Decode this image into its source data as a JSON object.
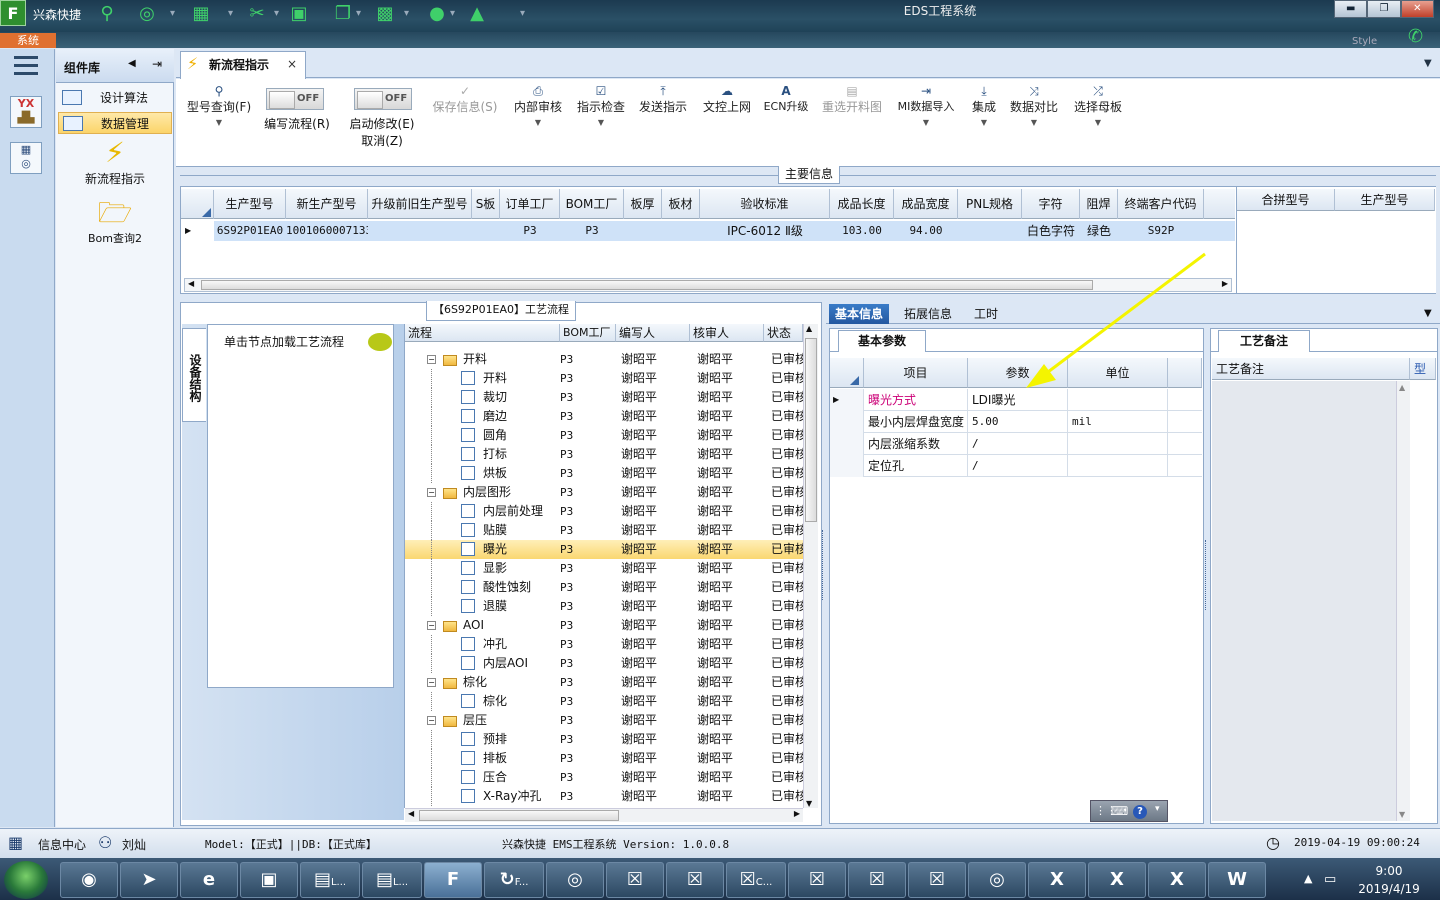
{
  "app": {
    "short_name": "兴森快捷",
    "window_title": "EDS工程系统",
    "system_tab": "系统",
    "style_label": "Style"
  },
  "quick_access": [
    {
      "icon": "search-icon"
    },
    {
      "icon": "lifebuoy-icon"
    },
    {
      "icon": "grid-icon"
    },
    {
      "icon": "scissors-icon"
    },
    {
      "icon": "film-icon"
    },
    {
      "icon": "copy-icon"
    },
    {
      "icon": "apps-icon"
    },
    {
      "icon": "user-icon"
    },
    {
      "icon": "chart-icon"
    }
  ],
  "window_controls": {
    "minimize": "▬",
    "restore": "❐",
    "close": "✕"
  },
  "left_strip": {
    "icon1_text": "YX",
    "icons": [
      "menu-icon",
      "factory-icon",
      "calendar-icon"
    ]
  },
  "component_panel": {
    "title": "组件库",
    "items": [
      {
        "label": "设计算法"
      },
      {
        "label": "数据管理"
      }
    ],
    "big_items": [
      {
        "label": "新流程指示",
        "icon": "lightning-icon"
      },
      {
        "label": "Bom查询2",
        "icon": "folder-open-icon"
      }
    ]
  },
  "doc_tab": {
    "label": "新流程指示",
    "close": "×"
  },
  "toolbar": {
    "items": [
      {
        "label": "型号查询(F)",
        "icon": "search-icon"
      },
      {
        "label": "保存信息(S)",
        "icon": "check-icon",
        "disabled": true
      },
      {
        "label": "内部审核",
        "icon": "printer-icon"
      },
      {
        "label": "指示检查",
        "icon": "checkbox-icon"
      },
      {
        "label": "发送指示",
        "icon": "upload-icon"
      },
      {
        "label": "文控上网",
        "icon": "cloud-upload-icon"
      },
      {
        "label": "ECN升级",
        "icon": "letter-a-icon"
      },
      {
        "label": "重选开料图",
        "icon": "image-icon",
        "disabled": true
      },
      {
        "label": "MI数据导入",
        "icon": "import-icon"
      },
      {
        "label": "集成",
        "icon": "download-icon"
      },
      {
        "label": "数据对比",
        "icon": "compare-icon"
      },
      {
        "label": "选择母板",
        "icon": "shuffle-icon"
      }
    ],
    "toggles": [
      {
        "state": "OFF",
        "label": "编写流程(R)"
      },
      {
        "state": "OFF",
        "label1": "启动修改(E)",
        "label2": "取消(Z)"
      }
    ]
  },
  "main_info": {
    "title": "主要信息",
    "columns": [
      "生产型号",
      "新生产型号",
      "升级前旧生产型号",
      "S板",
      "订单工厂",
      "BOM工厂",
      "板厚",
      "板材",
      "验收标准",
      "成品长度",
      "成品宽度",
      "PNL规格",
      "字符",
      "阻焊",
      "终端客户代码"
    ],
    "row": [
      "6S92P01EA0",
      "10010600071339",
      "",
      "",
      "P3",
      "P3",
      "",
      "",
      "IPC-6012 Ⅱ级",
      "103.00",
      "94.00",
      "",
      "白色字符",
      "绿色",
      "S92P"
    ],
    "side_columns": [
      "合拼型号",
      "生产型号"
    ]
  },
  "process": {
    "title": "【6S92P01EA0】工艺流程",
    "side_tab": "设备结构",
    "hint": "单击节点加载工艺流程",
    "columns": [
      "流程",
      "BOM工厂",
      "编写人",
      "核审人",
      "状态"
    ],
    "rows": [
      {
        "level": 0,
        "name": "开料",
        "factory": "P3",
        "writer": "谢昭平",
        "reviewer": "谢昭平",
        "status": "已审核"
      },
      {
        "level": 1,
        "name": "开料",
        "factory": "P3",
        "writer": "谢昭平",
        "reviewer": "谢昭平",
        "status": "已审核"
      },
      {
        "level": 1,
        "name": "裁切",
        "factory": "P3",
        "writer": "谢昭平",
        "reviewer": "谢昭平",
        "status": "已审核"
      },
      {
        "level": 1,
        "name": "磨边",
        "factory": "P3",
        "writer": "谢昭平",
        "reviewer": "谢昭平",
        "status": "已审核"
      },
      {
        "level": 1,
        "name": "圆角",
        "factory": "P3",
        "writer": "谢昭平",
        "reviewer": "谢昭平",
        "status": "已审核"
      },
      {
        "level": 1,
        "name": "打标",
        "factory": "P3",
        "writer": "谢昭平",
        "reviewer": "谢昭平",
        "status": "已审核"
      },
      {
        "level": 1,
        "name": "烘板",
        "factory": "P3",
        "writer": "谢昭平",
        "reviewer": "谢昭平",
        "status": "已审核"
      },
      {
        "level": 0,
        "name": "内层图形",
        "factory": "P3",
        "writer": "谢昭平",
        "reviewer": "谢昭平",
        "status": "已审核"
      },
      {
        "level": 1,
        "name": "内层前处理",
        "factory": "P3",
        "writer": "谢昭平",
        "reviewer": "谢昭平",
        "status": "已审核"
      },
      {
        "level": 1,
        "name": "贴膜",
        "factory": "P3",
        "writer": "谢昭平",
        "reviewer": "谢昭平",
        "status": "已审核"
      },
      {
        "level": 1,
        "name": "曝光",
        "factory": "P3",
        "writer": "谢昭平",
        "reviewer": "谢昭平",
        "status": "已审核",
        "selected": true
      },
      {
        "level": 1,
        "name": "显影",
        "factory": "P3",
        "writer": "谢昭平",
        "reviewer": "谢昭平",
        "status": "已审核"
      },
      {
        "level": 1,
        "name": "酸性蚀刻",
        "factory": "P3",
        "writer": "谢昭平",
        "reviewer": "谢昭平",
        "status": "已审核"
      },
      {
        "level": 1,
        "name": "退膜",
        "factory": "P3",
        "writer": "谢昭平",
        "reviewer": "谢昭平",
        "status": "已审核"
      },
      {
        "level": 0,
        "name": "AOI",
        "factory": "P3",
        "writer": "谢昭平",
        "reviewer": "谢昭平",
        "status": "已审核"
      },
      {
        "level": 1,
        "name": "冲孔",
        "factory": "P3",
        "writer": "谢昭平",
        "reviewer": "谢昭平",
        "status": "已审核"
      },
      {
        "level": 1,
        "name": "内层AOI",
        "factory": "P3",
        "writer": "谢昭平",
        "reviewer": "谢昭平",
        "status": "已审核"
      },
      {
        "level": 0,
        "name": "棕化",
        "factory": "P3",
        "writer": "谢昭平",
        "reviewer": "谢昭平",
        "status": "已审核"
      },
      {
        "level": 1,
        "name": "棕化",
        "factory": "P3",
        "writer": "谢昭平",
        "reviewer": "谢昭平",
        "status": "已审核"
      },
      {
        "level": 0,
        "name": "层压",
        "factory": "P3",
        "writer": "谢昭平",
        "reviewer": "谢昭平",
        "status": "已审核"
      },
      {
        "level": 1,
        "name": "预排",
        "factory": "P3",
        "writer": "谢昭平",
        "reviewer": "谢昭平",
        "status": "已审核"
      },
      {
        "level": 1,
        "name": "排板",
        "factory": "P3",
        "writer": "谢昭平",
        "reviewer": "谢昭平",
        "status": "已审核"
      },
      {
        "level": 1,
        "name": "压合",
        "factory": "P3",
        "writer": "谢昭平",
        "reviewer": "谢昭平",
        "status": "已审核"
      },
      {
        "level": 1,
        "name": "X-Ray冲孔",
        "factory": "P3",
        "writer": "谢昭平",
        "reviewer": "谢昭平",
        "status": "已审核"
      }
    ]
  },
  "right_panel": {
    "tabs": [
      "基本信息",
      "拓展信息",
      "工时"
    ],
    "basic_tab": "基本参数",
    "param_columns": [
      "项目",
      "参数",
      "单位"
    ],
    "params": [
      {
        "item": "曝光方式",
        "value": "LDI曝光",
        "unit": ""
      },
      {
        "item": "最小内层焊盘宽度",
        "value": "5.00",
        "unit": "mil"
      },
      {
        "item": "内层涨缩系数",
        "value": "/",
        "unit": ""
      },
      {
        "item": "定位孔",
        "value": "/",
        "unit": ""
      }
    ],
    "remark_tab": "工艺备注",
    "remark_columns": [
      "工艺备注",
      "型"
    ],
    "highlight_color": "#cc0077"
  },
  "status_bar": {
    "info_center": "信息中心",
    "user": "刘灿",
    "model": "Model:【正式】||DB:【正式库】",
    "version": "兴森快捷 EMS工程系统 Version: 1.0.0.8",
    "datetime": "2019-04-19 09:00:24"
  },
  "taskbar": {
    "items": [
      {
        "label": "",
        "icon": "shell-icon"
      },
      {
        "label": "",
        "icon": "paper-plane-icon"
      },
      {
        "label": "",
        "icon": "ie-icon"
      },
      {
        "label": "",
        "icon": "save-icon"
      },
      {
        "label": "L...",
        "icon": "window-icon"
      },
      {
        "label": "L...",
        "icon": "window-icon"
      },
      {
        "label": "",
        "icon": "f-app-icon"
      },
      {
        "label": "F...",
        "icon": "f-red-icon"
      },
      {
        "label": "",
        "icon": "eye-icon"
      },
      {
        "label": "",
        "icon": "x-window-icon"
      },
      {
        "label": "",
        "icon": "x-window-icon"
      },
      {
        "label": "C...",
        "icon": "x-window-icon"
      },
      {
        "label": "",
        "icon": "x-window-icon"
      },
      {
        "label": "",
        "icon": "x-window-icon"
      },
      {
        "label": "",
        "icon": "x-window-icon"
      },
      {
        "label": "",
        "icon": "eye-icon"
      },
      {
        "label": "",
        "icon": "excel-icon"
      },
      {
        "label": "",
        "icon": "excel-icon"
      },
      {
        "label": "",
        "icon": "excel-icon"
      },
      {
        "label": "",
        "icon": "word-icon"
      }
    ],
    "time": "9:00",
    "date": "2019/4/19"
  }
}
